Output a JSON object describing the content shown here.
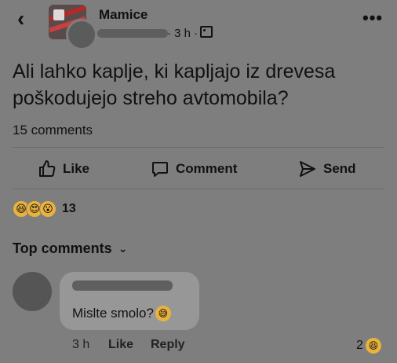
{
  "header": {
    "group_name": "Mamice",
    "time": "· 3 h ·",
    "more": "•••"
  },
  "post": {
    "text": "Ali lahko kaplje, ki kapljajo iz drevesa poškodujejo streho avtomobila?",
    "comment_count": "15 comments"
  },
  "actions": {
    "like": "Like",
    "comment": "Comment",
    "send": "Send"
  },
  "reactions": {
    "count": "13",
    "emojis": [
      "😆",
      "😍",
      "😮"
    ]
  },
  "comments_section": {
    "title": "Top comments",
    "chevron": "⌄"
  },
  "comment": {
    "text": "Mislte smolo?",
    "emoji": "😅",
    "time": "3 h",
    "like": "Like",
    "reply": "Reply",
    "reaction_count": "2",
    "reaction_emoji": "😆"
  }
}
